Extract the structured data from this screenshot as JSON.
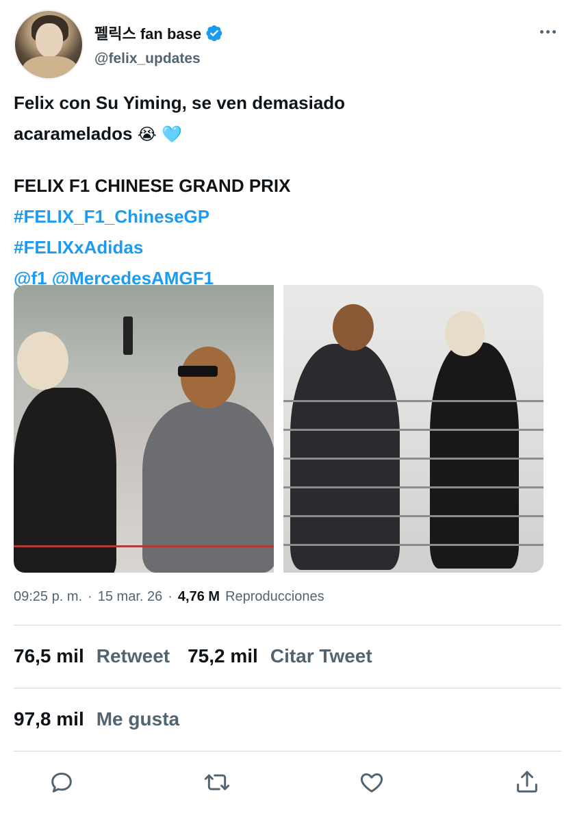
{
  "user": {
    "display_name": "펠릭스 fan base",
    "handle": "@felix_updates"
  },
  "tweet": {
    "line1": "Felix con Su Yiming, se ven demasiado",
    "line2": "acaramelados",
    "line2_emojis": "😭 🩵",
    "title": "FELIX F1 CHINESE GRAND PRIX",
    "hashtag1": "#FELIX_F1_ChineseGP",
    "hashtag2": "#FELIXxAdidas",
    "mention1": "@f1",
    "mention2": "@MercedesAMGF1"
  },
  "meta": {
    "time": "09:25 p. m.",
    "sep1": "·",
    "date": "15 mar. 26",
    "sep2": "·",
    "views_count": "4,76 M",
    "views_label": "Reproducciones"
  },
  "stats": {
    "retweets_count": "76,5 mil",
    "retweets_label": "Retweet",
    "quotes_count": "75,2 mil",
    "quotes_label": "Citar Tweet",
    "likes_count": "97,8 mil",
    "likes_label": "Me gusta"
  },
  "colors": {
    "link": "#1d9bf0",
    "secondary_text": "#536471",
    "primary_text": "#0f1419"
  },
  "icons": [
    "verified-badge-icon",
    "more-options-icon",
    "reply-icon",
    "retweet-icon",
    "like-icon",
    "share-icon"
  ]
}
